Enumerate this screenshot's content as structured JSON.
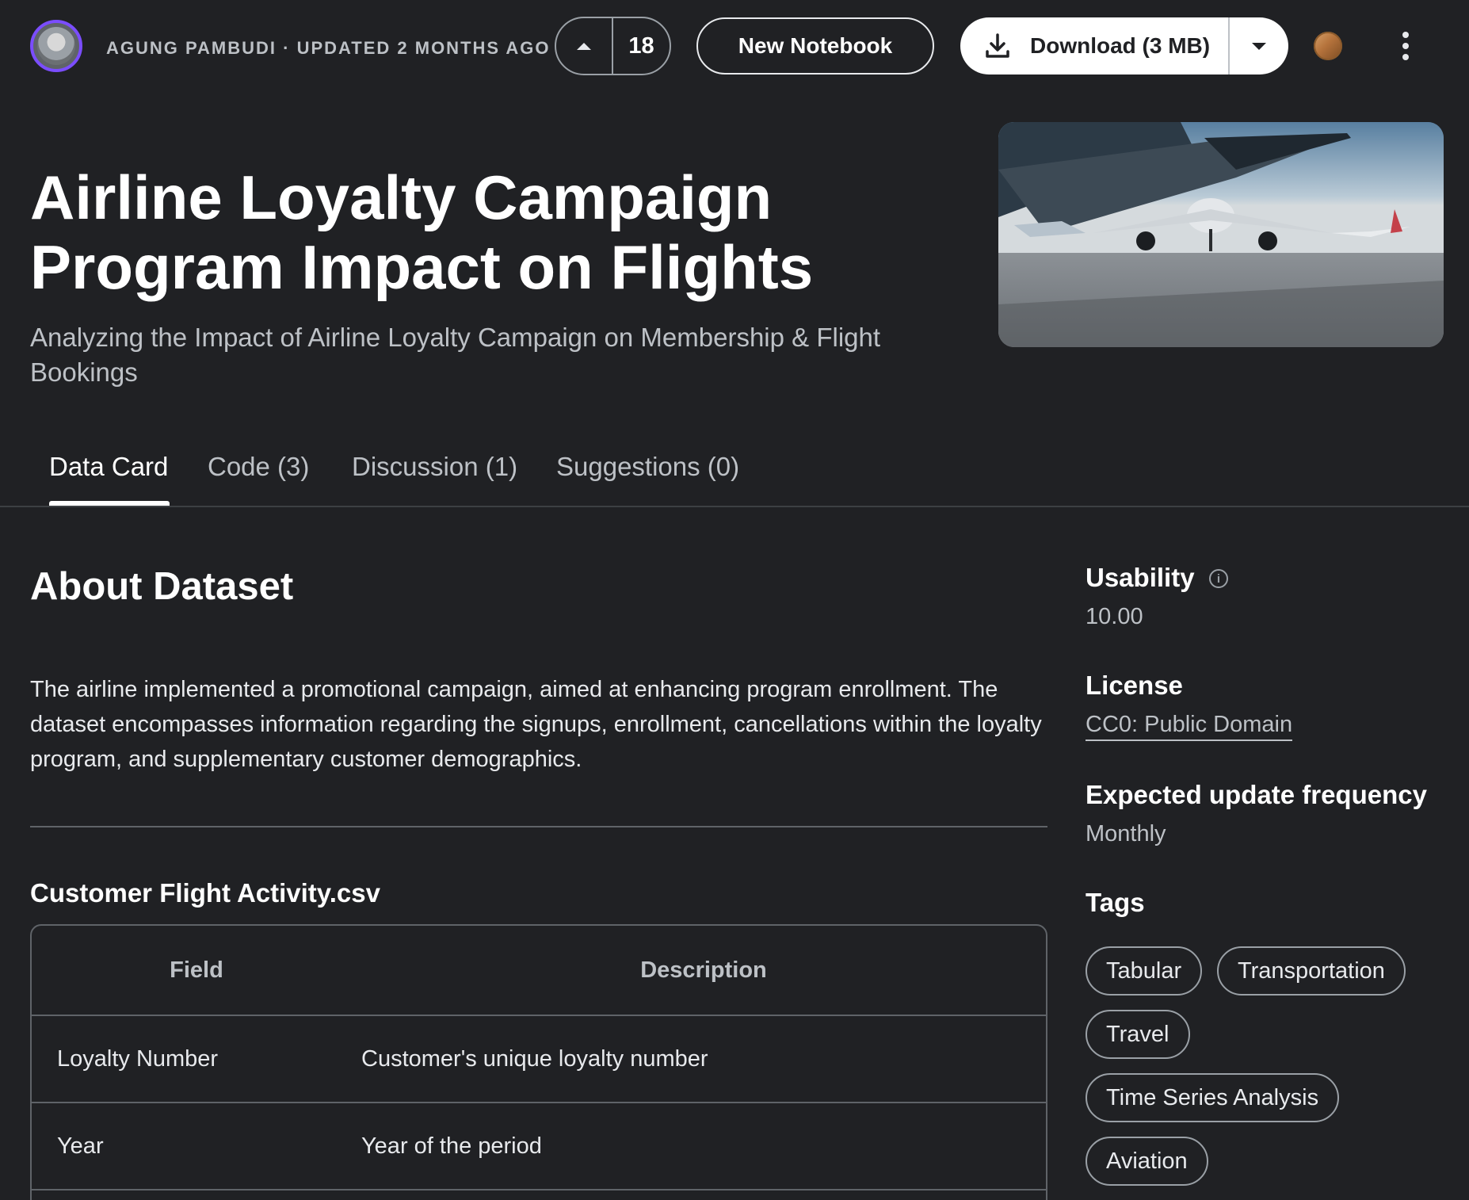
{
  "header": {
    "byline": "AGUNG PAMBUDI · UPDATED 2 MONTHS AGO",
    "vote_count": "18",
    "new_notebook_label": "New Notebook",
    "download_label": "Download (3 MB)"
  },
  "dataset": {
    "title": "Airline Loyalty Campaign Program Impact on Flights",
    "subtitle": "Analyzing the Impact of Airline Loyalty Campaign on Membership & Flight Bookings"
  },
  "tabs": [
    {
      "label": "Data Card",
      "active": true
    },
    {
      "label": "Code (3)",
      "active": false
    },
    {
      "label": "Discussion (1)",
      "active": false
    },
    {
      "label": "Suggestions (0)",
      "active": false
    }
  ],
  "about": {
    "heading": "About Dataset",
    "text": "The airline implemented a promotional campaign, aimed at enhancing program enrollment. The dataset encompasses information regarding the signups, enrollment, cancellations within the loyalty program, and supplementary customer demographics."
  },
  "file": {
    "name": "Customer Flight Activity.csv",
    "columns": [
      "Field",
      "Description"
    ],
    "rows": [
      {
        "field": "Loyalty Number",
        "description": "Customer's unique loyalty number"
      },
      {
        "field": "Year",
        "description": "Year of the period"
      }
    ]
  },
  "sidebar": {
    "usability_label": "Usability",
    "usability_value": "10.00",
    "license_label": "License",
    "license_value": "CC0: Public Domain",
    "frequency_label": "Expected update frequency",
    "frequency_value": "Monthly",
    "tags_label": "Tags",
    "tags": [
      "Tabular",
      "Transportation",
      "Travel",
      "Time Series Analysis",
      "Aviation"
    ]
  },
  "icons": {
    "info": "i"
  }
}
